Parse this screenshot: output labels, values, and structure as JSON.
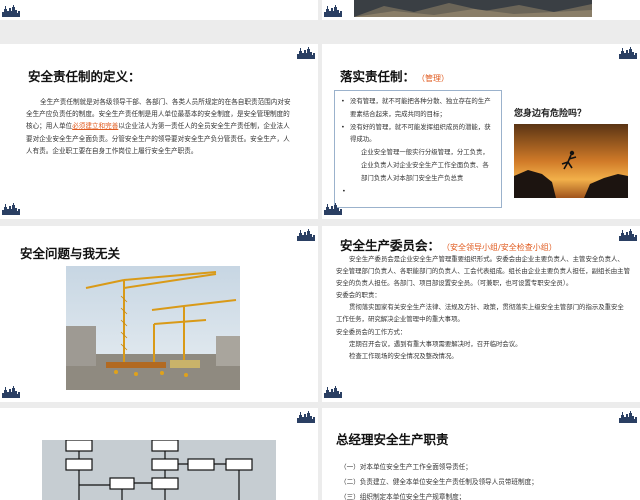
{
  "slides": {
    "definition": {
      "title": "安全责任制的定义：",
      "p1": "全生产责任制就是对各级领导干部、各部门、各类人员所规定的在各自职责范围内对安全生产应负责任的制度。安全生产责任制是用人单位最基本的安全制度，是安全管理制度的核心；用人单位",
      "p1_highlight": "必须建立和完善",
      "p1_end": "以企业法人为第一责任人的全员安全生产责任制，企业法人要对企业安全生产全面负责。分管安全生产的领导要对安全生产负分管责任。安全生产，人人有责。企业职工要在自身工作岗位上履行安全生产职责。"
    },
    "implement": {
      "title": "落实责任制：",
      "subtitle": "（管理）",
      "items": [
        "没有管理，就不可能把各种分散、独立存在的生产要素结合起来，完成共同的目标；",
        "没有好的管理，就不可能发挥组织成员的潜能，获得成功。"
      ],
      "para": "企业安全管理一般实行分级管理，分工负责，企业负责人对企业安全生产工作全面负责、各部门负责人对本部门安全生产负总责",
      "question": "您身边有危险吗？"
    },
    "unrelated": {
      "title": "安全问题与我无关"
    },
    "committee": {
      "title": "安全生产委员会：",
      "subtitle": "（安全领导小组/安全检查小组）",
      "lines": [
        "安全生产委员会是企业安全生产管理重要组织形式。安委会由企业主要负责人、主管安全负责人、安全管理部门负责人、各职能部门的负责人、工会代表组成。组长由企业主要负责人担任，副组长由主管安全的负责人担任。各部门、项目部设置安全员。（可兼职，也可设置专职安全员）。",
        "安委会的职责：",
        "贯彻落实国家有关安全生产法律、法规及方针、政策，贯彻落实上级安全主管部门的指示及重安全工作任务，研究解决企业管理中的重大事项。",
        "安全委员会的工作方式：",
        "定期召开会议，遇到有重大事项需要解决时，召开临时会议。",
        "检查工作现场的安全情况及整改情况。"
      ]
    },
    "gm": {
      "title": "总经理安全生产职责",
      "lines": [
        "（一）对本单位安全生产工作全面领导责任；",
        "（二）负责建立、健全本单位安全生产责任制及领导人员带班制度；",
        "（三）组织制定本单位安全生产规章制度；"
      ]
    }
  },
  "colors": {
    "accent": "#e05a1e",
    "navy": "#1c3d6e",
    "border": "#9bb2cc"
  }
}
